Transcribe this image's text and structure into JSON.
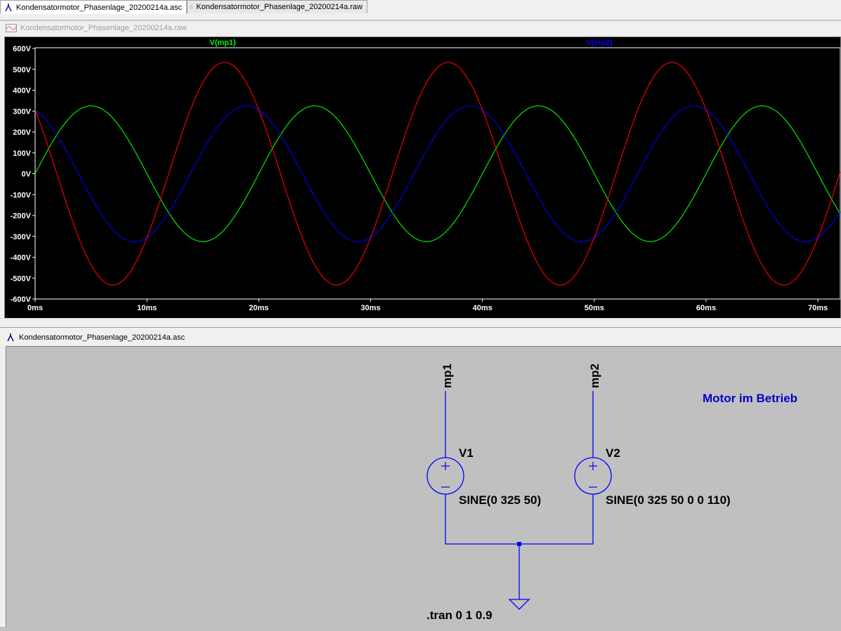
{
  "tabs": [
    {
      "label": "Kondensatormotor_Phasenlage_20200214a.asc",
      "icon": "schematic-icon",
      "active": true
    },
    {
      "label": "Kondensatormotor_Phasenlage_20200214a.raw",
      "icon": "waveform-icon",
      "active": false
    }
  ],
  "waveform_window": {
    "title": "Kondensatormotor_Phasenlage_20200214a.raw",
    "icon": "waveform-icon"
  },
  "schematic_window": {
    "title": "Kondensatormotor_Phasenlage_20200214a.asc",
    "icon": "schematic-icon"
  },
  "colors": {
    "mp1": "#00ff00",
    "mp2": "#0000ff",
    "diff": "#ff0000",
    "wire": "#0000ff",
    "plot_bg": "#000000",
    "schematic_bg": "#c0c0c0"
  },
  "chart_data": {
    "type": "line",
    "xlabel": "",
    "ylabel": "",
    "xlim": [
      0,
      72
    ],
    "ylim": [
      -600,
      600
    ],
    "x_ticks": [
      "0ms",
      "10ms",
      "20ms",
      "30ms",
      "40ms",
      "50ms",
      "60ms",
      "70ms"
    ],
    "y_ticks": [
      "600V",
      "500V",
      "400V",
      "300V",
      "200V",
      "100V",
      "0V",
      "-100V",
      "-200V",
      "-300V",
      "-400V",
      "-500V",
      "-600V"
    ],
    "grid": false,
    "legend": [
      "V(mp1)",
      "V(mp2)"
    ],
    "series": [
      {
        "name": "V(mp1)",
        "color": "#00ff00",
        "amplitude": 325,
        "frequency_hz": 50,
        "phase_deg": 0
      },
      {
        "name": "V(mp2)",
        "color": "#0000ff",
        "amplitude": 325,
        "frequency_hz": 50,
        "phase_deg": 110
      },
      {
        "color": "#ff0000",
        "amplitude": 533,
        "frequency_hz": 50,
        "phase_deg": 145
      }
    ]
  },
  "schematic": {
    "net_mp1": "mp1",
    "net_mp2": "mp2",
    "v1_name": "V1",
    "v1_value": "SINE(0 325 50)",
    "v2_name": "V2",
    "v2_value": "SINE(0 325 50 0 0 110)",
    "comment": "Motor im Betrieb",
    "directive": ".tran 0 1 0.9"
  }
}
